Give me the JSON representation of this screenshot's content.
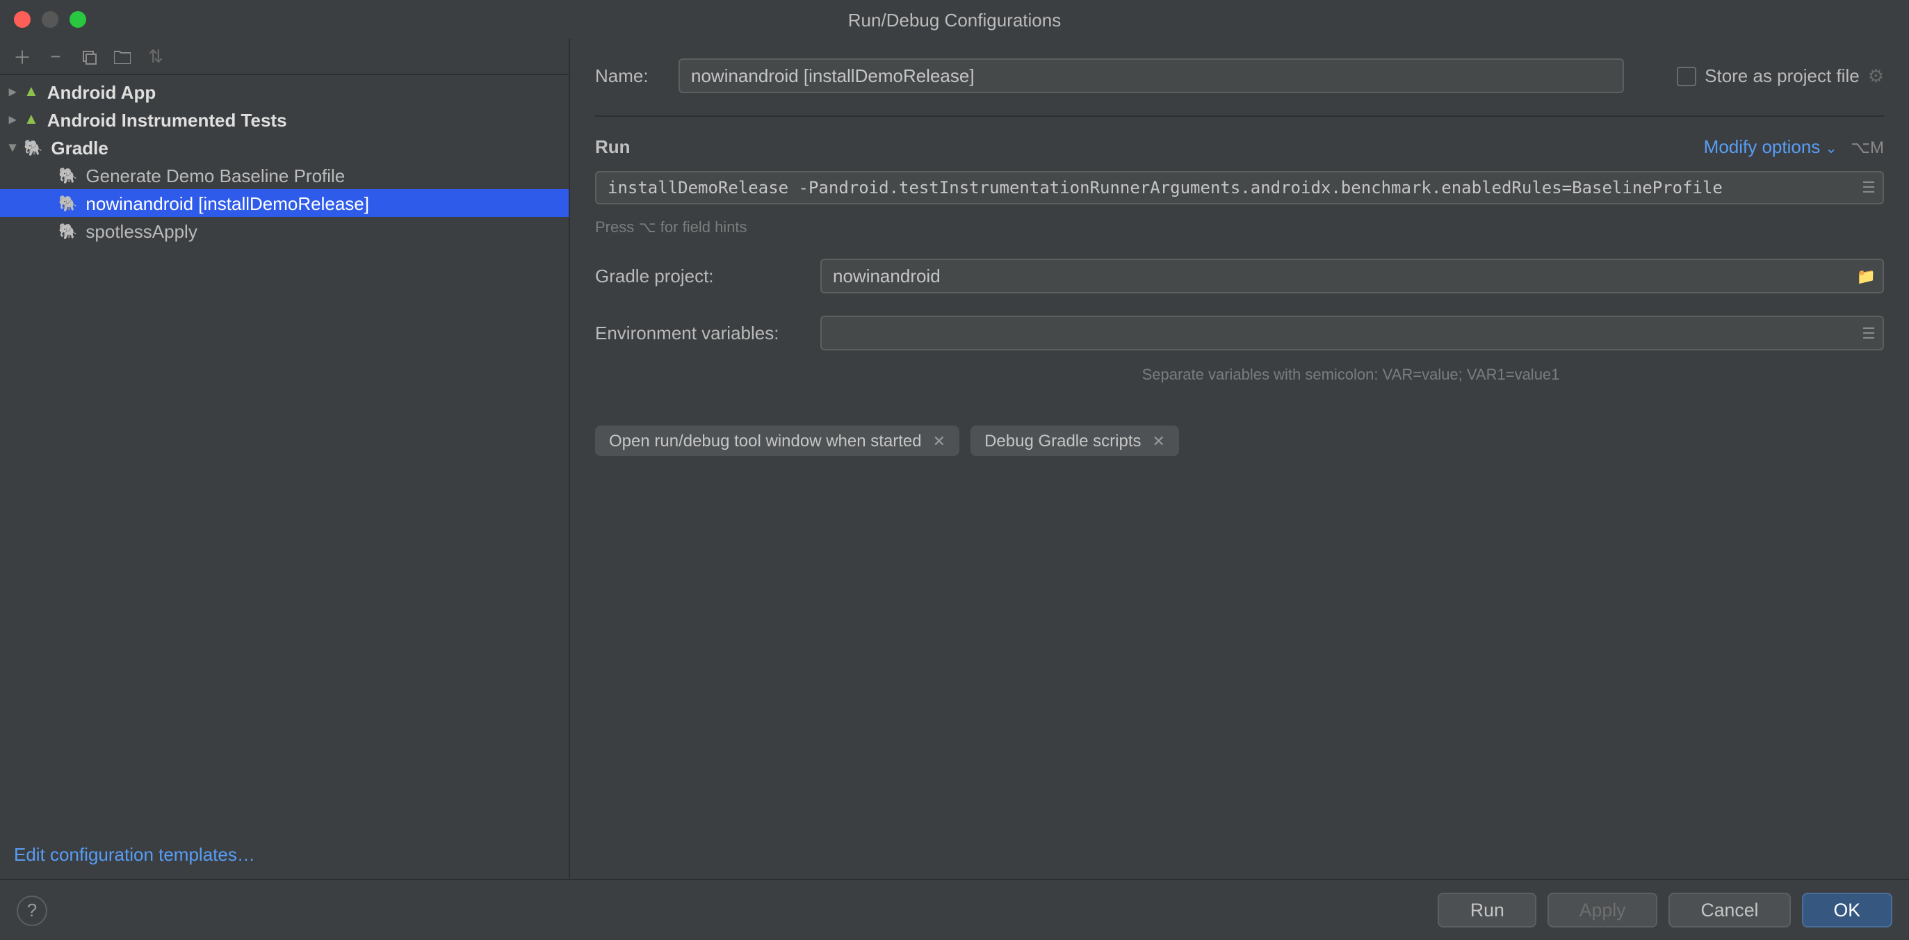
{
  "title": "Run/Debug Configurations",
  "toolbar": {
    "add": "＋",
    "remove": "−",
    "copy": "⧉",
    "folder": "▭",
    "sort": "↕"
  },
  "sidebar": {
    "items": [
      {
        "label": "Android App",
        "expanded": false,
        "kind": "android"
      },
      {
        "label": "Android Instrumented Tests",
        "expanded": false,
        "kind": "android"
      },
      {
        "label": "Gradle",
        "expanded": true,
        "kind": "gradle",
        "children": [
          {
            "label": "Generate Demo Baseline Profile"
          },
          {
            "label": "nowinandroid [installDemoRelease]",
            "selected": true
          },
          {
            "label": "spotlessApply"
          }
        ]
      }
    ],
    "edit_templates": "Edit configuration templates…"
  },
  "form": {
    "name_label": "Name:",
    "name_value": "nowinandroid [installDemoRelease]",
    "store_label": "Store as project file",
    "run_section": "Run",
    "modify_label": "Modify options",
    "modify_kbd": "⌥M",
    "tasks_value": "installDemoRelease -Pandroid.testInstrumentationRunnerArguments.androidx.benchmark.enabledRules=BaselineProfile",
    "hint_tasks": "Press ⌥ for field hints",
    "gradle_project_label": "Gradle project:",
    "gradle_project_value": "nowinandroid",
    "env_label": "Environment variables:",
    "env_value": "",
    "env_hint": "Separate variables with semicolon: VAR=value; VAR1=value1",
    "chips": [
      "Open run/debug tool window when started",
      "Debug Gradle scripts"
    ]
  },
  "footer": {
    "run": "Run",
    "apply": "Apply",
    "cancel": "Cancel",
    "ok": "OK"
  }
}
